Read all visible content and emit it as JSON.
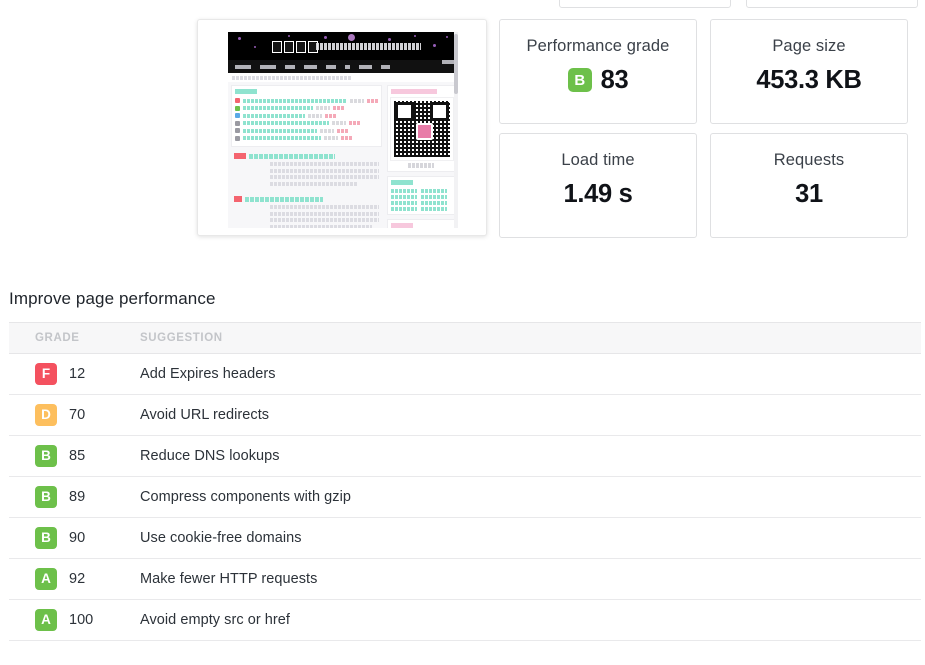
{
  "summary": {
    "cards": [
      {
        "id": "performance-grade",
        "label": "Performance grade",
        "grade": "B",
        "value": "83",
        "has_badge": true
      },
      {
        "id": "page-size",
        "label": "Page size",
        "grade": "",
        "value": "453.3 KB",
        "has_badge": false
      },
      {
        "id": "load-time",
        "label": "Load time",
        "grade": "",
        "value": "1.49 s",
        "has_badge": false
      },
      {
        "id": "requests",
        "label": "Requests",
        "grade": "",
        "value": "31",
        "has_badge": false
      }
    ]
  },
  "suggestions": {
    "title": "Improve page performance",
    "columns": {
      "grade": "Grade",
      "suggestion": "Suggestion"
    },
    "rows": [
      {
        "grade": "F",
        "score": "12",
        "suggestion": "Add Expires headers"
      },
      {
        "grade": "D",
        "score": "70",
        "suggestion": "Avoid URL redirects"
      },
      {
        "grade": "B",
        "score": "85",
        "suggestion": "Reduce DNS lookups"
      },
      {
        "grade": "B",
        "score": "89",
        "suggestion": "Compress components with gzip"
      },
      {
        "grade": "B",
        "score": "90",
        "suggestion": "Use cookie-free domains"
      },
      {
        "grade": "A",
        "score": "92",
        "suggestion": "Make fewer HTTP requests"
      },
      {
        "grade": "A",
        "score": "100",
        "suggestion": "Avoid empty src or href"
      }
    ]
  },
  "thumbnail": {
    "alt": "website-screenshot-thumbnail"
  },
  "colors": {
    "grade_a": "#6dc04a",
    "grade_b": "#6dc04a",
    "grade_d": "#fdbf5e",
    "grade_f": "#f4515f",
    "card_border": "#dfe0e2",
    "text_primary": "#2c3239",
    "header_text": "#c3c5c9"
  }
}
